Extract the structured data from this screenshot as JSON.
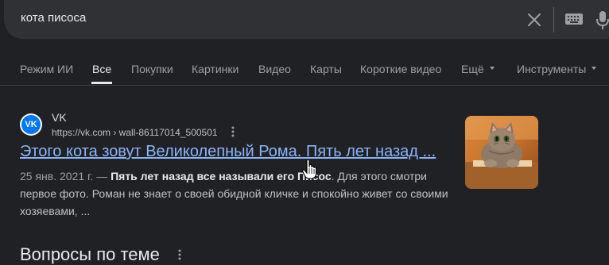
{
  "search": {
    "query": "кота писоса"
  },
  "tabs": [
    {
      "label": "Режим ИИ"
    },
    {
      "label": "Все"
    },
    {
      "label": "Покупки"
    },
    {
      "label": "Картинки"
    },
    {
      "label": "Видео"
    },
    {
      "label": "Карты"
    },
    {
      "label": "Короткие видео"
    },
    {
      "label": "Ещё"
    },
    {
      "label": "Инструменты"
    }
  ],
  "result": {
    "site_name": "VK",
    "url": "https://vk.com › wall-86117014_500501",
    "favicon_text": "VK",
    "title": "Этого кота зовут Великолепный Рома. Пять лет назад ...",
    "date": "25 янв. 2021 г. —",
    "snippet_bold": "Пять лет назад все называли его Писос",
    "snippet_rest": ". Для этого смотри первое фото. Роман не знает о своей обидной кличке и спокойно живет со своими хозяевами, ..."
  },
  "related": {
    "title": "Вопросы по теме"
  },
  "colors": {
    "background": "#202124",
    "link": "#8ab4f8",
    "vk_brand": "#0077ff"
  }
}
